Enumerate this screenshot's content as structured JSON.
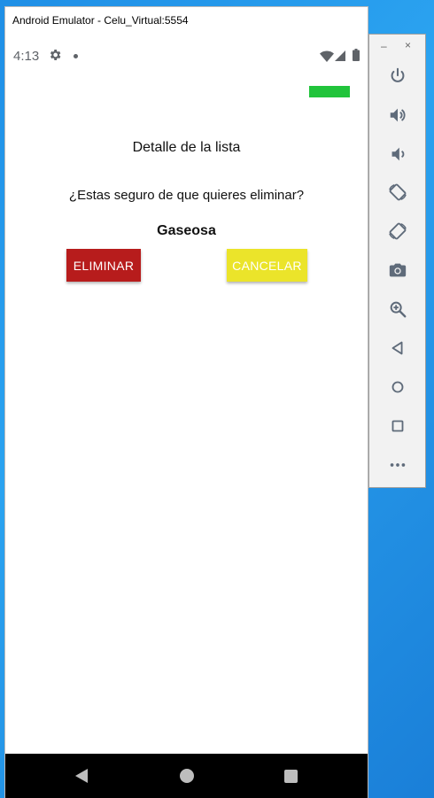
{
  "window": {
    "title": "Android Emulator - Celu_Virtual:5554"
  },
  "status_bar": {
    "time": "4:13",
    "icons": [
      "gear-icon",
      "notification-dot-icon",
      "wifi-icon",
      "signal-icon",
      "battery-icon"
    ]
  },
  "screen": {
    "accent_bar_color": "#21c43b",
    "list_title": "Detalle de la lista",
    "question": "¿Estas seguro de que quieres eliminar?",
    "item_name": "Gaseosa",
    "buttons": {
      "eliminar": {
        "label": "ELIMINAR",
        "color": "#b71c1c"
      },
      "cancelar": {
        "label": "CANCELAR",
        "color": "#ebe42a"
      }
    }
  },
  "nav_bar": {
    "icons": [
      "back-icon",
      "home-icon",
      "recents-icon"
    ]
  },
  "toolbar": {
    "minimize": "–",
    "close": "×",
    "icons": [
      "power-icon",
      "volume-up-icon",
      "volume-down-icon",
      "rotate-left-icon",
      "rotate-right-icon",
      "camera-icon",
      "zoom-icon",
      "back-icon",
      "home-icon",
      "overview-icon",
      "more-icon"
    ]
  }
}
